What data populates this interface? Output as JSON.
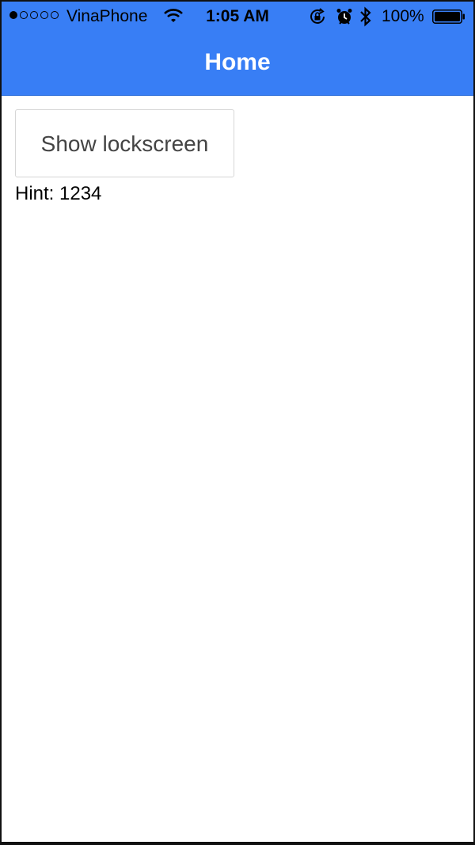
{
  "status_bar": {
    "carrier": "VinaPhone",
    "time": "1:05 AM",
    "battery_percent": "100%",
    "signal_bars_filled": 1,
    "signal_bars_total": 5
  },
  "header": {
    "title": "Home",
    "background_color": "#387ef5"
  },
  "main": {
    "show_lockscreen_label": "Show lockscreen",
    "hint_text": "Hint: 1234"
  },
  "icons": [
    "wifi-icon",
    "rotation-lock-icon",
    "alarm-icon",
    "bluetooth-icon",
    "battery-icon"
  ]
}
